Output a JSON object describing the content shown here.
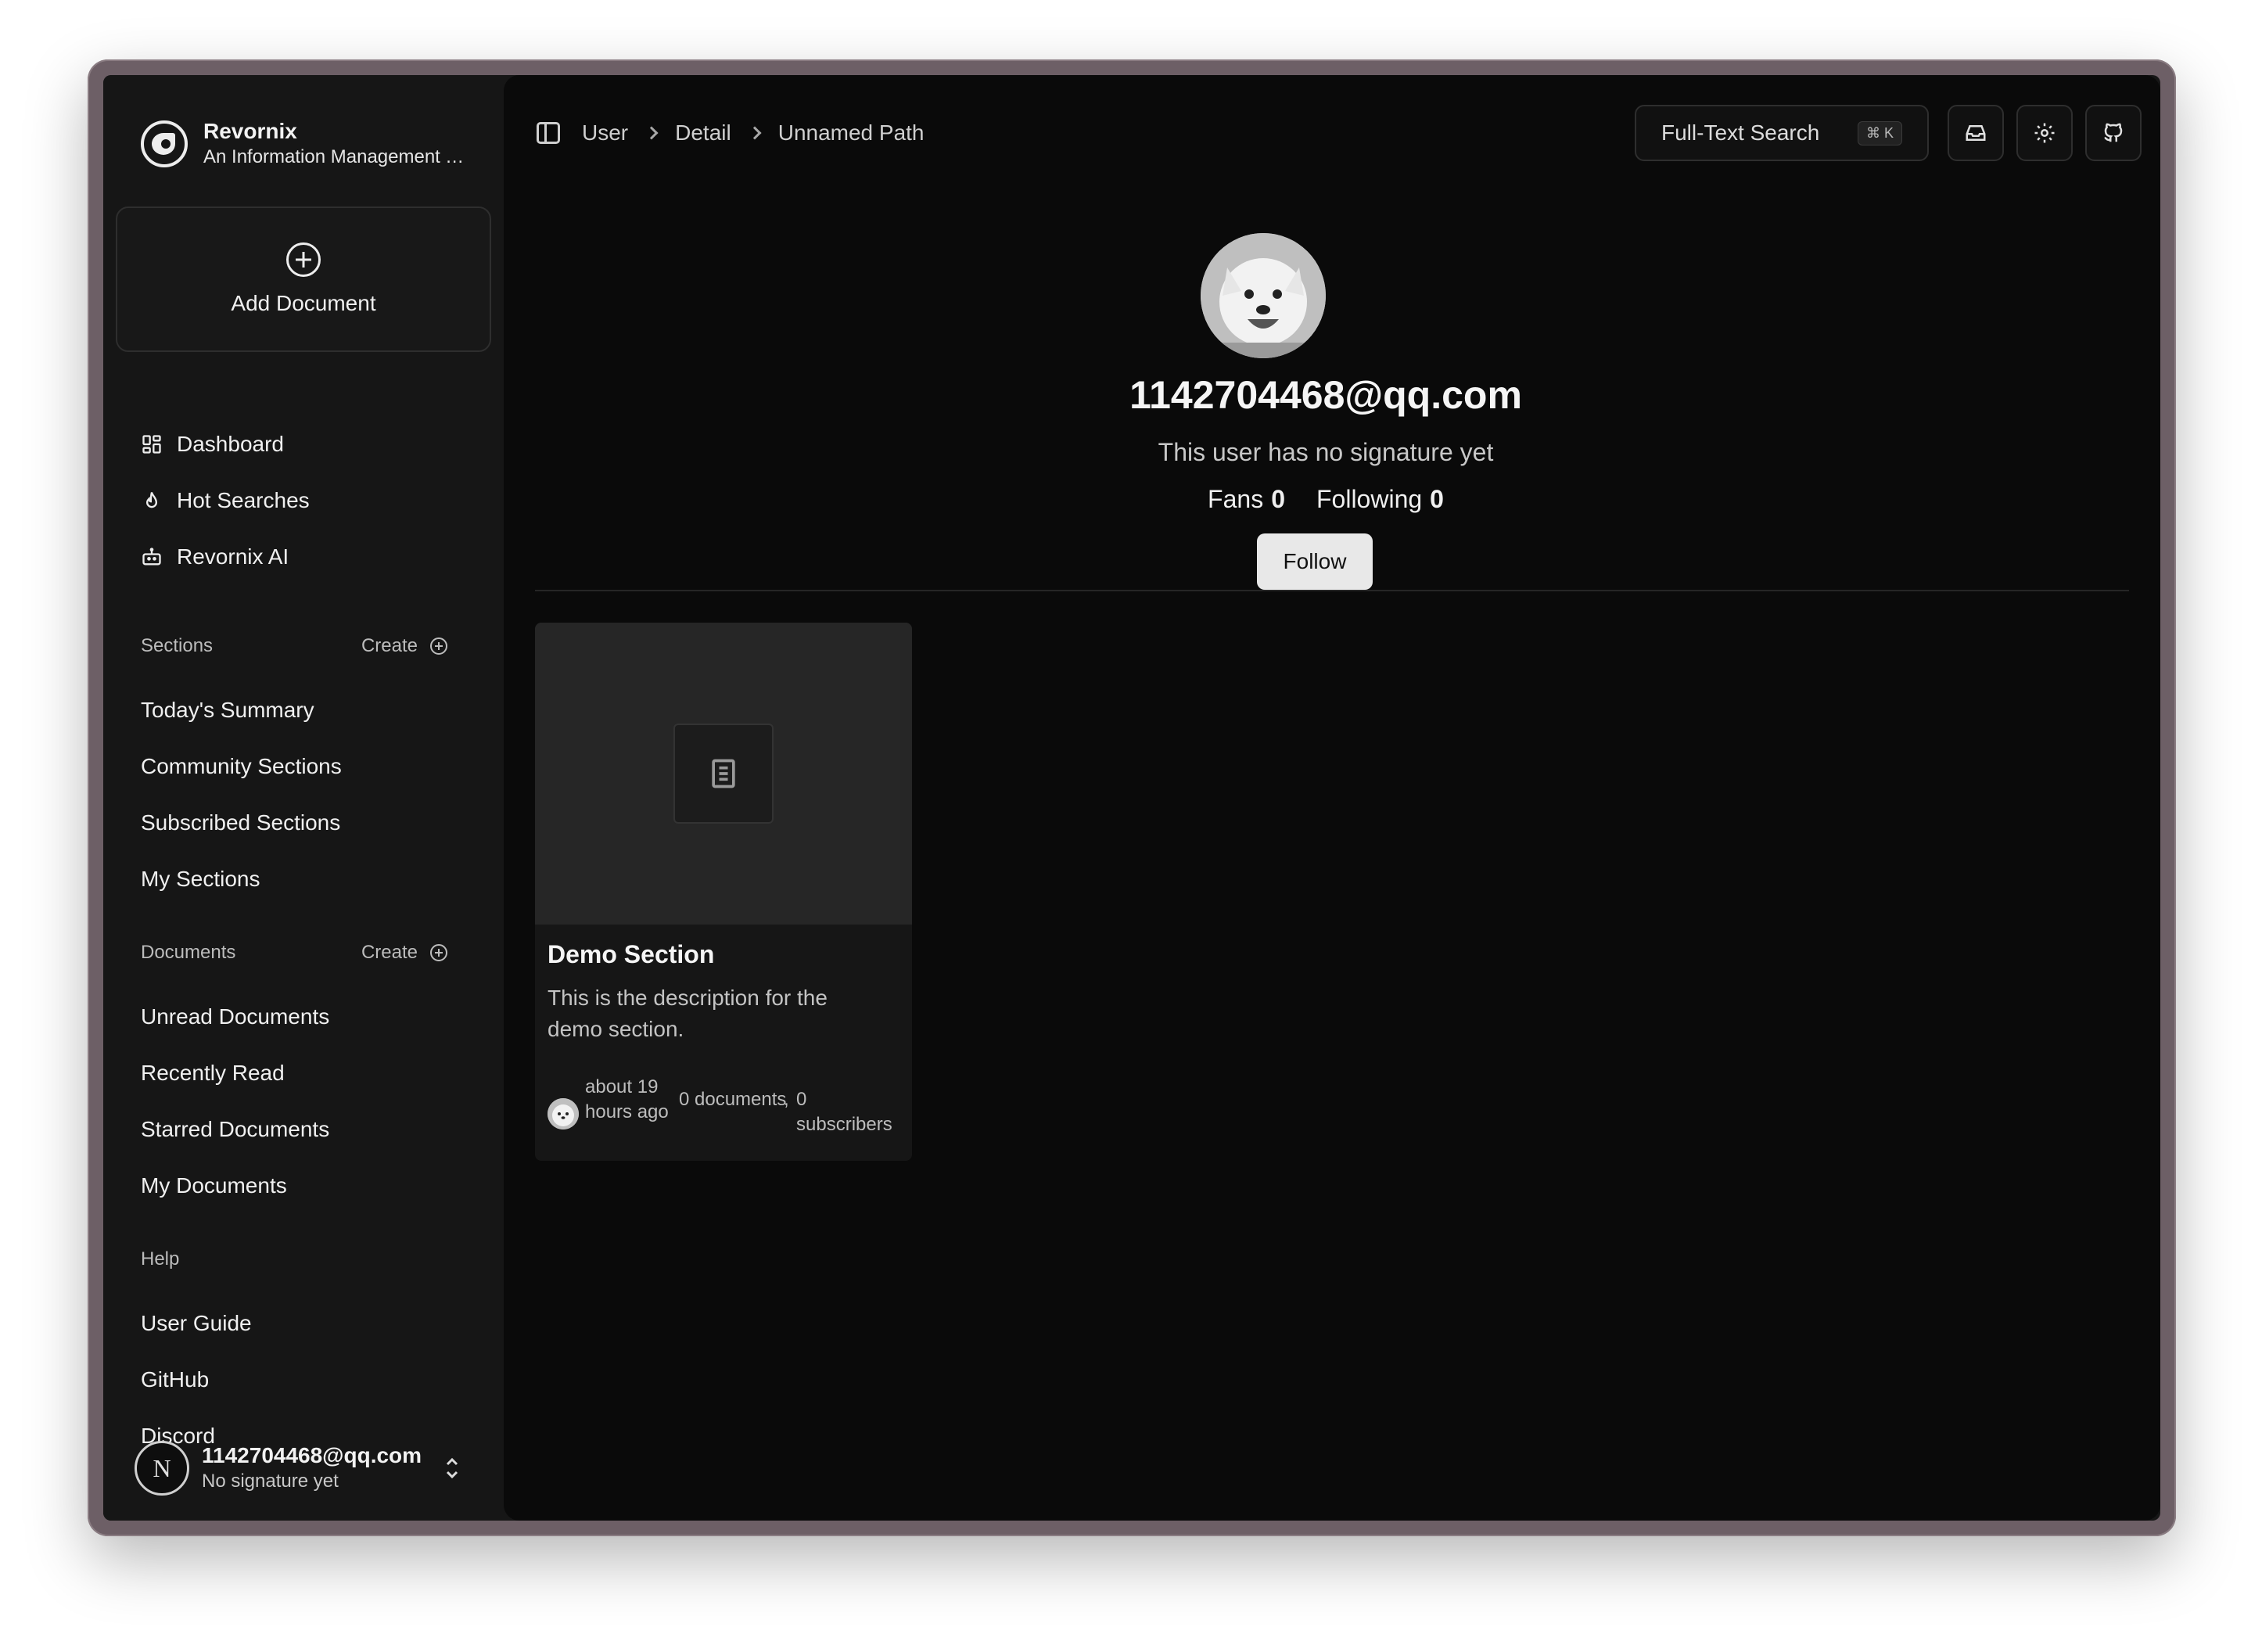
{
  "brand": {
    "name": "Revornix",
    "subtitle": "An Information Management Tool"
  },
  "sidebar": {
    "add_document": "Add Document",
    "nav": [
      {
        "label": "Dashboard",
        "icon": "dashboard-icon"
      },
      {
        "label": "Hot Searches",
        "icon": "flame-icon"
      },
      {
        "label": "Revornix AI",
        "icon": "bot-icon"
      }
    ],
    "sections": {
      "title": "Sections",
      "create": "Create",
      "items": [
        "Today's Summary",
        "Community Sections",
        "Subscribed Sections",
        "My Sections"
      ]
    },
    "documents": {
      "title": "Documents",
      "create": "Create",
      "items": [
        "Unread Documents",
        "Recently Read",
        "Starred Documents",
        "My Documents"
      ]
    },
    "help": {
      "title": "Help",
      "items": [
        "User Guide",
        "GitHub",
        "Discord"
      ]
    },
    "user": {
      "avatar_letter": "N",
      "email": "1142704468@qq.com",
      "signature": "No signature yet"
    }
  },
  "topbar": {
    "breadcrumb": [
      "User",
      "Detail",
      "Unnamed Path"
    ],
    "search_label": "Full-Text Search",
    "search_shortcut": "⌘ K"
  },
  "profile": {
    "email": "1142704468@qq.com",
    "signature": "This user has no signature yet",
    "fans_label": "Fans",
    "fans_count": "0",
    "following_label": "Following",
    "following_count": "0",
    "follow_button": "Follow"
  },
  "sections_list": [
    {
      "title": "Demo Section",
      "description": "This is the description for the demo section.",
      "updated": "about 19 hours ago",
      "documents": "0 documents",
      "subscribers": "0 subscribers"
    }
  ],
  "colors": {
    "window_frame": "#6d5f66",
    "sidebar_bg": "#161616",
    "main_bg": "#0a0a0a",
    "follow_button_bg": "#e8e8e8"
  }
}
